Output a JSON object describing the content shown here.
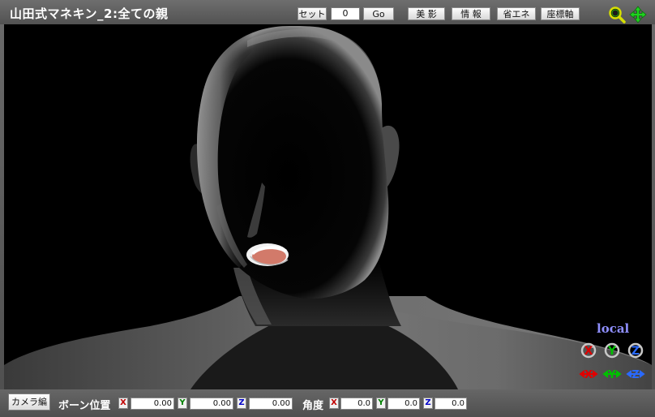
{
  "window": {
    "title": "山田式マネキン_2:全ての親"
  },
  "toolbar": {
    "set_label": "セット",
    "frame_value": "0",
    "go_label": "Go",
    "beauty_shadow_label": "美 影",
    "info_label": "情 報",
    "eco_label": "省エネ",
    "axis_label": "座標軸",
    "zoom_icon": "magnifier-icon",
    "move_icon": "move-arrows-icon"
  },
  "viewport": {
    "coord_mode": "local",
    "rotate_icons": [
      "rotate-x-icon",
      "rotate-y-icon",
      "rotate-z-icon"
    ],
    "move_icons": [
      "move-x-icon",
      "move-y-icon",
      "move-z-icon"
    ],
    "rotate_labels": [
      "X",
      "Y",
      "Z"
    ],
    "move_labels": [
      "X",
      "Y",
      "Z"
    ]
  },
  "bottom": {
    "camera_edit_label": "カメラ編",
    "bone_position_label": "ボーン位置",
    "angle_label": "角度",
    "position": {
      "x": "0.00",
      "y": "0.00",
      "z": "0.00"
    },
    "angle": {
      "x": "0.0",
      "y": "0.0",
      "z": "0.0"
    },
    "axis_x": "X",
    "axis_y": "Y",
    "axis_z": "Z"
  },
  "colors": {
    "axis_x": "#c00000",
    "axis_y": "#008000",
    "axis_z": "#0000c8",
    "local_text": "#8f8fff",
    "viewport_bg": "#000000"
  }
}
